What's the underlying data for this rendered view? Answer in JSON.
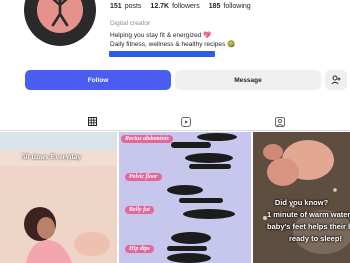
{
  "profile": {
    "stats": [
      {
        "value": "151",
        "label": "posts"
      },
      {
        "value": "12.7K",
        "label": "followers"
      },
      {
        "value": "185",
        "label": "following"
      }
    ],
    "category": "Digital creator",
    "bio_line1": "Helping you stay fit & energized 💖",
    "bio_line2": "Daily fitness, wellness & healthy recipes 🥝"
  },
  "actions": {
    "follow_label": "Follow",
    "message_label": "Message"
  },
  "tabs": [
    {
      "icon": "grid-icon",
      "active": true
    },
    {
      "icon": "reels-icon",
      "active": false
    },
    {
      "icon": "tagged-icon",
      "active": false
    }
  ],
  "posts": {
    "post1_caption": "50 times Everyday",
    "post2_labels": [
      "Rectus abdominis",
      "Pelvic floor",
      "Belly fat",
      "Hip dips"
    ],
    "post3_lines": [
      "Did you know?",
      "1 minute of warm water",
      "baby's feet helps their b",
      "ready to sleep!"
    ]
  },
  "colors": {
    "follow_button": "#4a5df0",
    "link_highlight": "#2d5de8",
    "label_pink": "#e4679a"
  }
}
